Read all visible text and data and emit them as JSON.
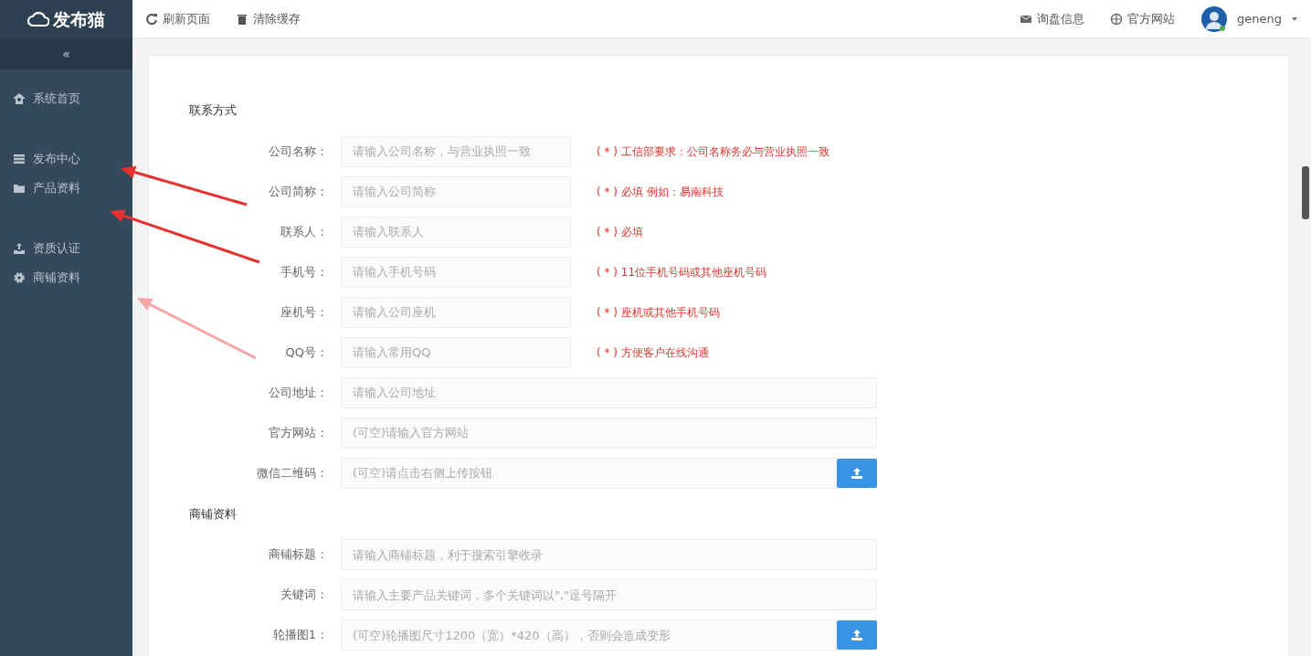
{
  "logo": {
    "text": "发布猫"
  },
  "sidebar": {
    "collapse": "«",
    "items": [
      {
        "label": "系统首页"
      },
      {
        "label": "发布中心"
      },
      {
        "label": "产品资料"
      },
      {
        "label": "资质认证"
      },
      {
        "label": "商铺资料"
      }
    ]
  },
  "toolbar": [
    {
      "label": "刷新页面"
    },
    {
      "label": "清除缓存"
    }
  ],
  "topbar_right": [
    {
      "label": "询盘信息"
    },
    {
      "label": "官方网站"
    }
  ],
  "user": {
    "name": "geneng"
  },
  "sections": [
    {
      "title": "联系方式",
      "fields": [
        {
          "kind": "short",
          "label": "公司名称：",
          "placeholder": "请输入公司名称，与营业执照一致",
          "hint": "( * ) 工信部要求：公司名称务必与营业执照一致"
        },
        {
          "kind": "short",
          "label": "公司简称：",
          "placeholder": "请输入公司简称",
          "hint": "( * ) 必填 例如：易南科技"
        },
        {
          "kind": "short",
          "label": "联系人：",
          "placeholder": "请输入联系人",
          "hint": "( * ) 必填"
        },
        {
          "kind": "short",
          "label": "手机号：",
          "placeholder": "请输入手机号码",
          "hint": "( * ) 11位手机号码或其他座机号码"
        },
        {
          "kind": "short",
          "label": "座机号：",
          "placeholder": "请输入公司座机",
          "hint": "( * ) 座机或其他手机号码"
        },
        {
          "kind": "short",
          "label": "QQ号：",
          "placeholder": "请输入常用QQ",
          "hint": "( * ) 方便客户在线沟通"
        },
        {
          "kind": "wide",
          "label": "公司地址：",
          "placeholder": "请输入公司地址"
        },
        {
          "kind": "wide",
          "label": "官方网站：",
          "placeholder": "(可空)请输入官方网站"
        },
        {
          "kind": "upload",
          "label": "微信二维码：",
          "placeholder": "(可空)请点击右侧上传按钮"
        }
      ]
    },
    {
      "title": "商铺资料",
      "fields": [
        {
          "kind": "wide",
          "label": "商铺标题：",
          "placeholder": "请输入商铺标题，利于搜索引擎收录"
        },
        {
          "kind": "wide",
          "label": "关键词：",
          "placeholder": "请输入主要产品关键词，多个关键词以\",\"逗号隔开"
        },
        {
          "kind": "upload",
          "label": "轮播图1：",
          "placeholder": "(可空)轮播图尺寸1200（宽）*420（高），否则会造成变形"
        }
      ]
    }
  ]
}
